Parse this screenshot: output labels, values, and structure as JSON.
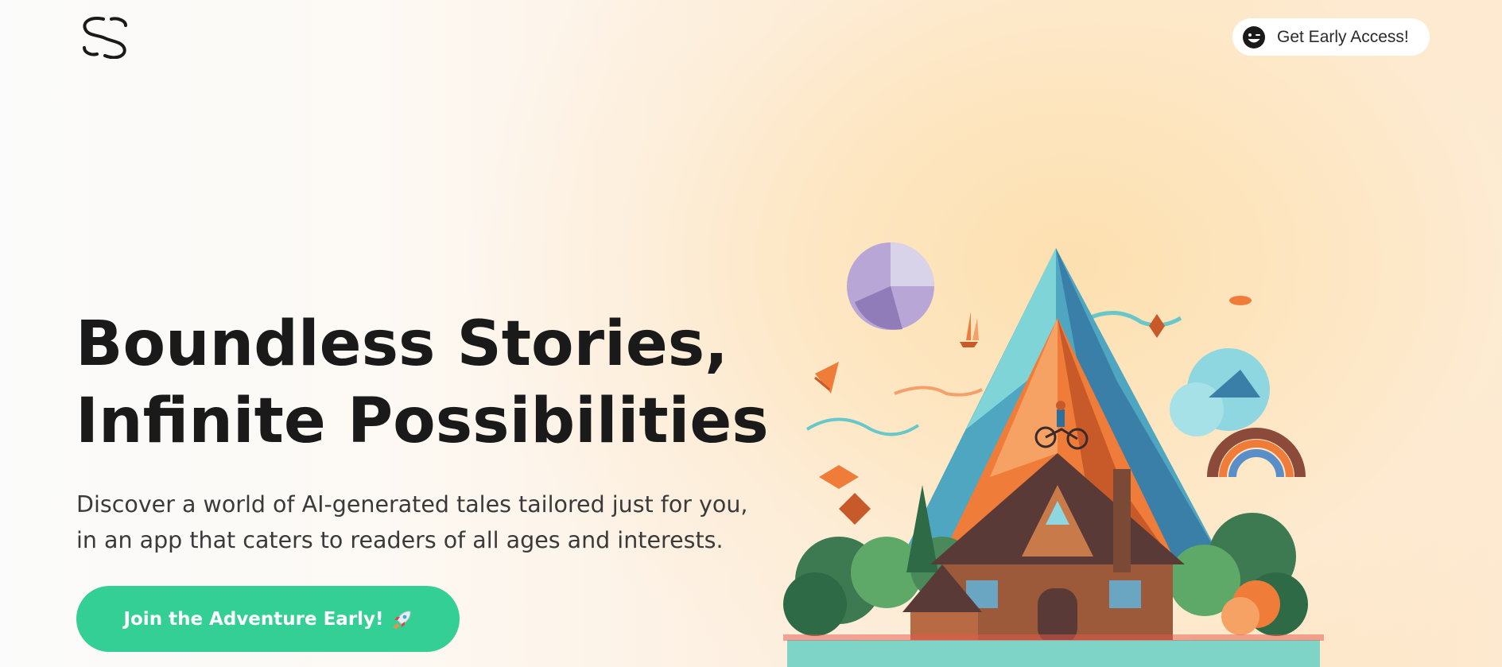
{
  "header": {
    "logo_icon": "storyverse-s-logo-icon",
    "cta_label": "Get Early Access!",
    "cta_icon": "smiley-wink-icon"
  },
  "hero": {
    "title_line1": "Boundless Stories,",
    "title_line2": "Infinite Possibilities",
    "subtitle_line1": "Discover a world of AI-generated tales tailored just for you,",
    "subtitle_line2": "in an app that caters to readers of all ages and interests.",
    "button_label": "Join the Adventure Early!",
    "button_icon": "rocket-icon"
  },
  "illustration": {
    "subject": "mountain-house-fantasy-illustration"
  },
  "colors": {
    "accent": "#34cf94",
    "text_dark": "#1a1a1a",
    "background_warm": "#fde0b0"
  }
}
